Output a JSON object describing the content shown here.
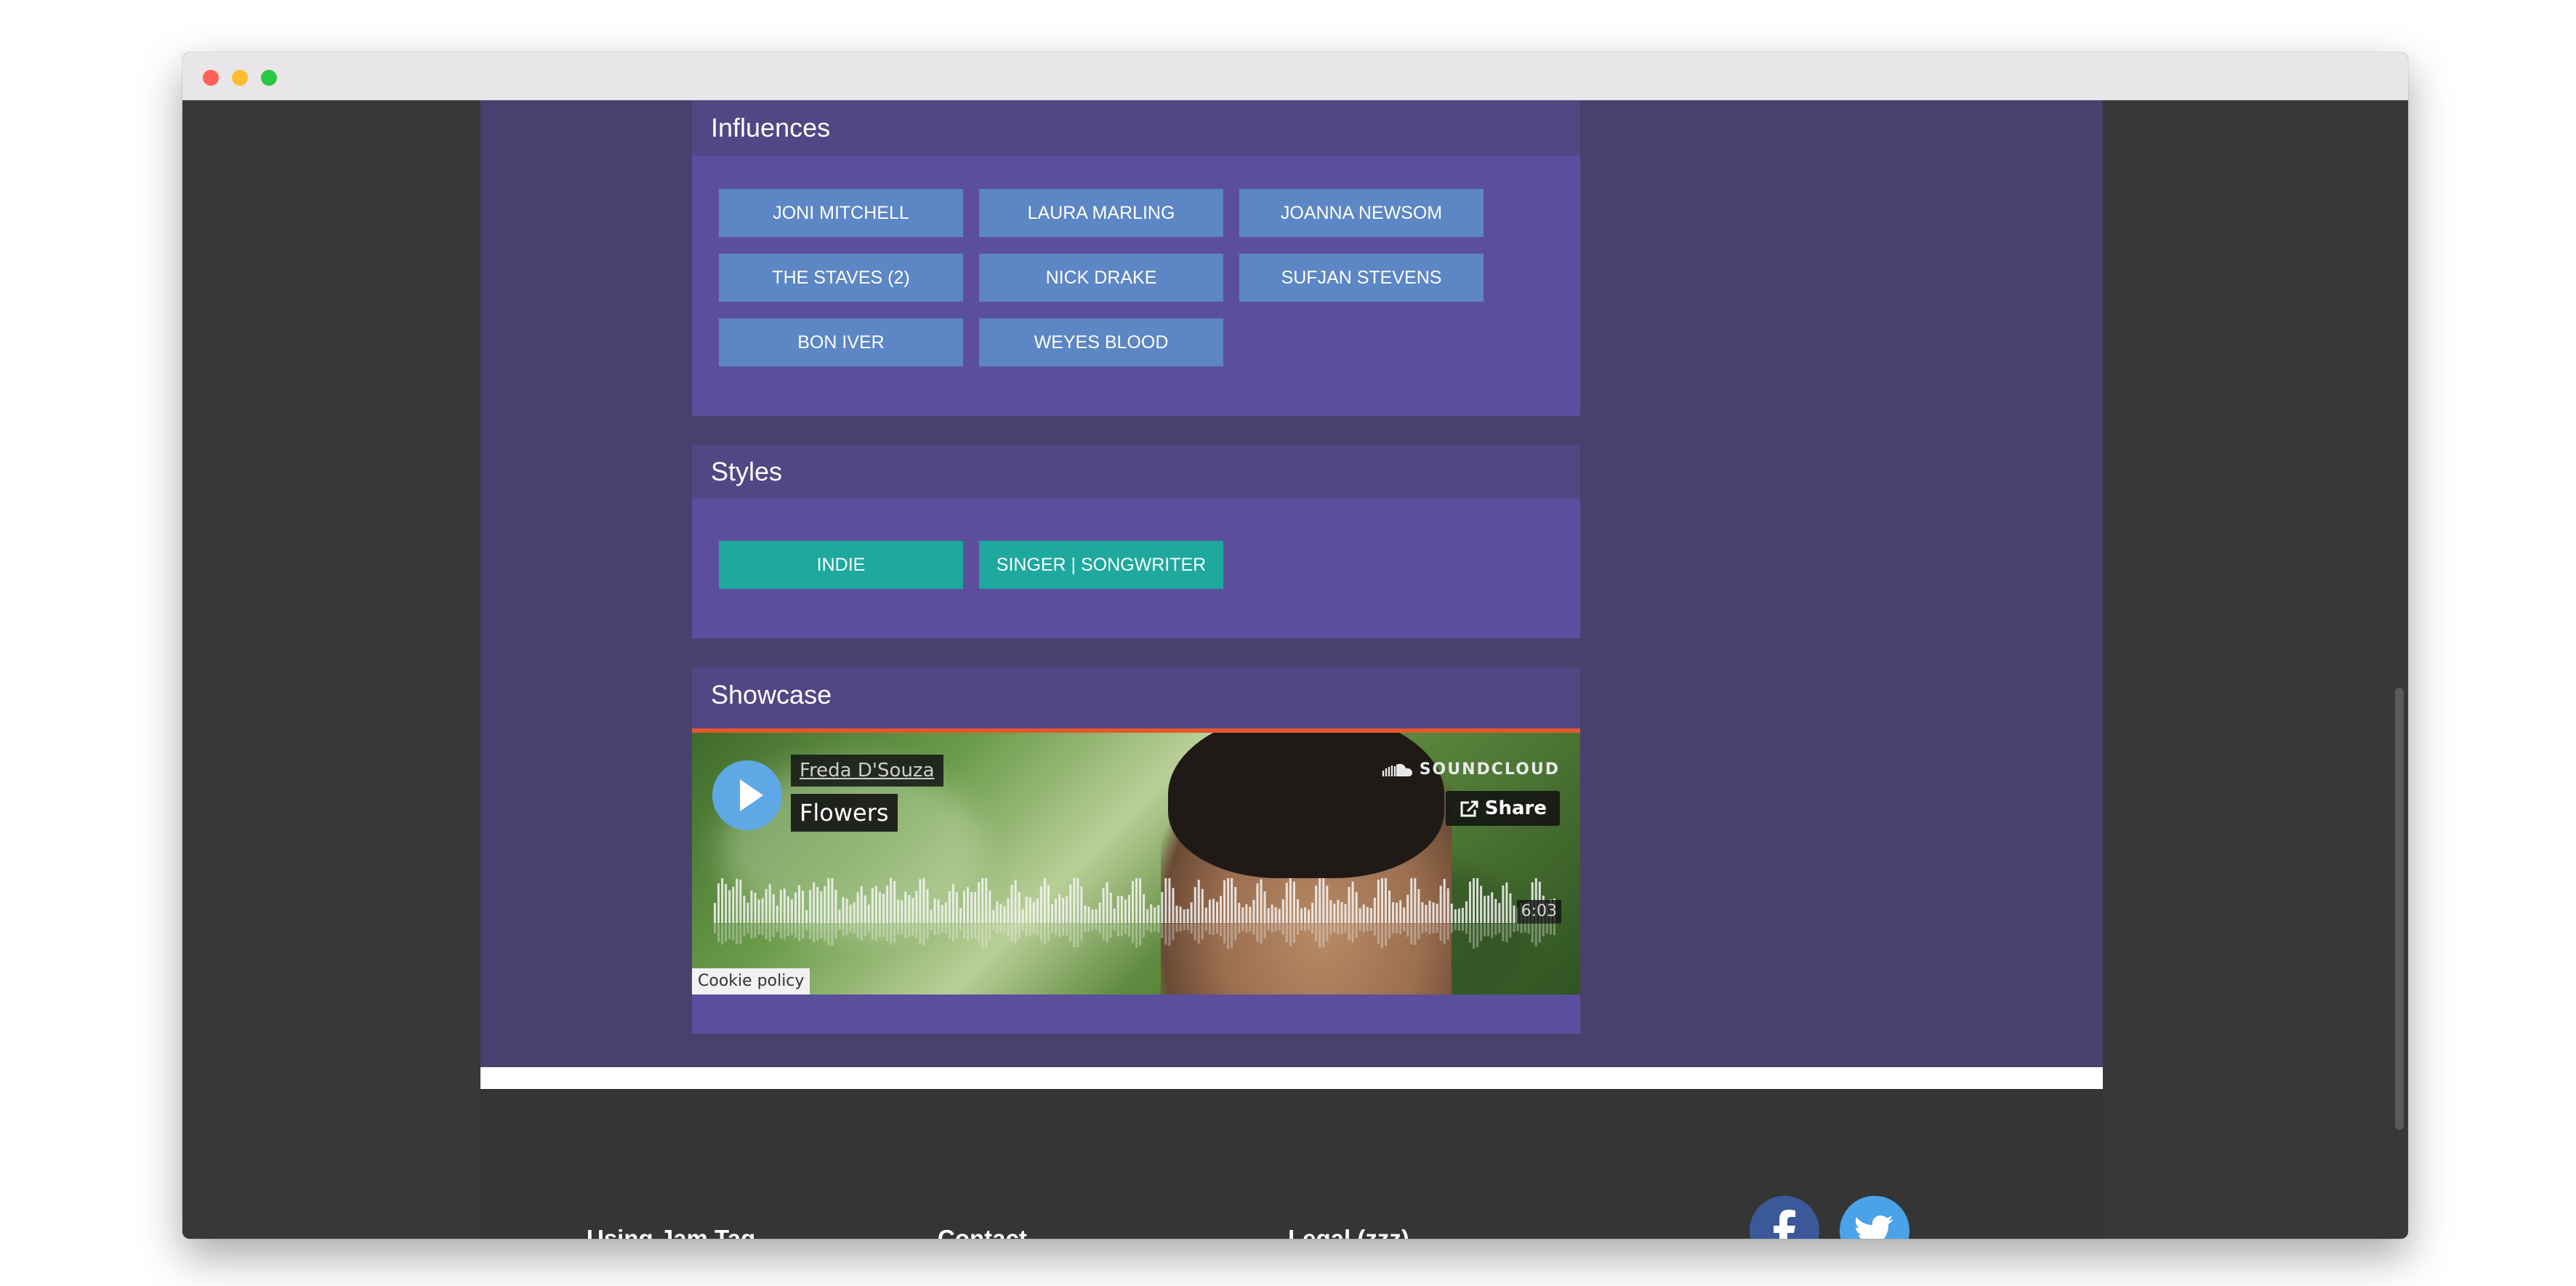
{
  "influences": {
    "title": "Influences",
    "tags": [
      "JONI MITCHELL",
      "LAURA MARLING",
      "JOANNA NEWSOM",
      "THE STAVES (2)",
      "NICK DRAKE",
      "SUFJAN STEVENS",
      "BON IVER",
      "WEYES BLOOD"
    ]
  },
  "styles": {
    "title": "Styles",
    "tags": [
      "INDIE",
      "SINGER | SONGWRITER"
    ]
  },
  "showcase": {
    "title": "Showcase",
    "player": {
      "artist": "Freda D'Souza",
      "track": "Flowers",
      "brand": "SOUNDCLOUD",
      "share_label": "Share",
      "duration": "6:03",
      "cookie_label": "Cookie policy"
    }
  },
  "footer": {
    "links": [
      "Using Jam Tag",
      "Contact",
      "Legal (zzz)"
    ],
    "social": [
      "facebook-icon",
      "twitter-icon"
    ]
  },
  "colors": {
    "page_bg": "#4a406d",
    "card_bg": "#5b4f9d",
    "card_header": "#514784",
    "influence_tag": "#5c86c4",
    "style_tag": "#1ea89e",
    "footer_bg": "#353535",
    "soundcloud_accent": "#e4572e"
  }
}
